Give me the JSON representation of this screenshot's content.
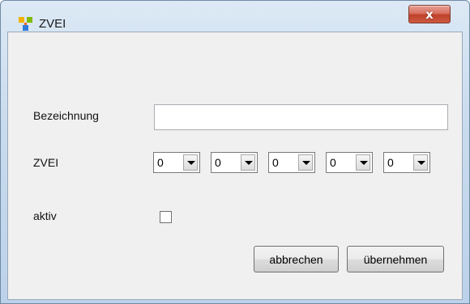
{
  "window": {
    "title": "ZVEI",
    "close_label": "x",
    "app_icon": "app-grid-icon"
  },
  "form": {
    "bezeichnung_label": "Bezeichnung",
    "bezeichnung_value": "",
    "zvei_label": "ZVEI",
    "zvei_digits": [
      "0",
      "0",
      "0",
      "0",
      "0"
    ],
    "aktiv_label": "aktiv",
    "aktiv_checked": false
  },
  "buttons": {
    "cancel_label": "abbrechen",
    "apply_label": "übernehmen"
  },
  "colors": {
    "close_red": "#c0412a",
    "titlebar_blue": "#c9dbee",
    "client_bg": "#f0f0f0"
  }
}
